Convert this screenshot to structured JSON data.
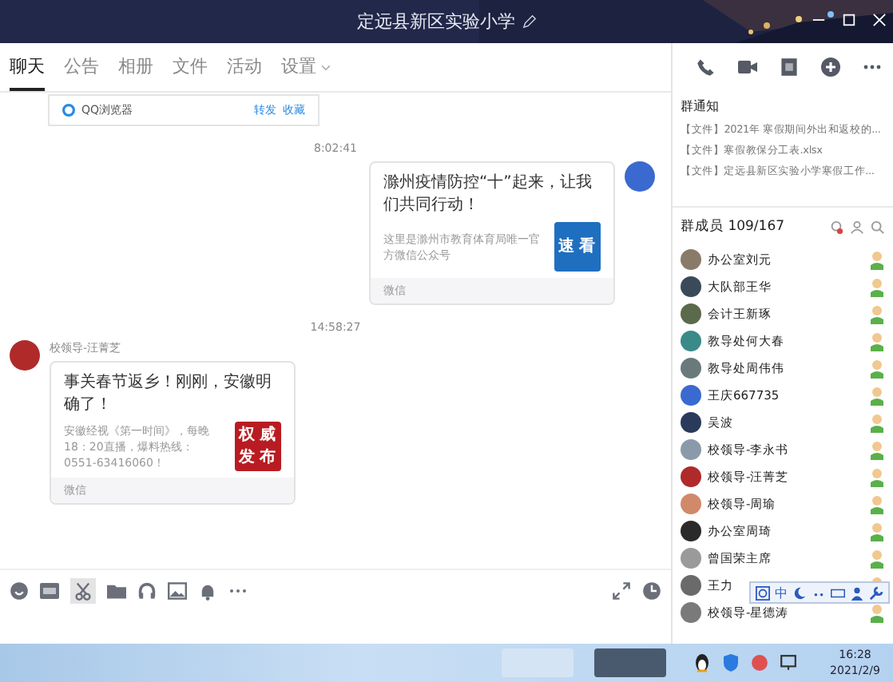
{
  "window": {
    "title": "定远县新区实验小学"
  },
  "tabs": [
    {
      "label": "聊天",
      "selected": true
    },
    {
      "label": "公告",
      "selected": false
    },
    {
      "label": "相册",
      "selected": false
    },
    {
      "label": "文件",
      "selected": false
    },
    {
      "label": "活动",
      "selected": false
    },
    {
      "label": "设置",
      "selected": false
    }
  ],
  "browser_bar": {
    "label": "QQ浏览器",
    "actions": [
      "转发",
      "收藏"
    ]
  },
  "messages": [
    {
      "kind": "time",
      "text": "8:02:41"
    },
    {
      "kind": "sent",
      "title": "滁州疫情防控“十”起来，让我们共同行动！",
      "desc": "这里是滁州市教育体育局唯一官方微信公众号",
      "thumb": "速看",
      "source": "微信"
    },
    {
      "kind": "time",
      "text": "14:58:27"
    },
    {
      "kind": "received",
      "sender": "校领导-汪菁芝",
      "title": "事关春节返乡！刚刚，安徽明确了！",
      "desc": "安徽经视《第一时间》，每晚18：20直播，爆料热线：0551-63416060！",
      "thumb": "权威发布",
      "source": "微信"
    }
  ],
  "notice": {
    "title": "群通知",
    "items": [
      "【文件】2021年 寒假期间外出和返校的...",
      "【文件】寒假教保分工表.xlsx",
      "【文件】定远县新区实验小学寒假工作..."
    ]
  },
  "members": {
    "title": "群成员 109/167",
    "items": [
      {
        "name": "办公室刘元",
        "color": "#8a7a6a"
      },
      {
        "name": "大队部王华",
        "color": "#3a4a5a"
      },
      {
        "name": "会计王新琢",
        "color": "#5a6a4a"
      },
      {
        "name": "教导处何大春",
        "color": "#3a8a8a"
      },
      {
        "name": "教导处周伟伟",
        "color": "#6a7a7a"
      },
      {
        "name": "王庆667735",
        "color": "#3a6ad0"
      },
      {
        "name": "吴波",
        "color": "#2a3a5a"
      },
      {
        "name": "校领导-李永书",
        "color": "#8a9aaa"
      },
      {
        "name": "校领导-汪菁芝",
        "color": "#b02a2a"
      },
      {
        "name": "校领导-周瑜",
        "color": "#d08a6a"
      },
      {
        "name": "办公室周琦",
        "color": "#2a2a2a"
      },
      {
        "name": "曾国荣主席",
        "color": "#9a9a9a"
      },
      {
        "name": "王力",
        "color": "#6a6a6a"
      },
      {
        "name": "校领导-星德涛",
        "color": "#7a7a7a"
      }
    ]
  },
  "ime": {
    "label": "中"
  },
  "clock": {
    "time": "16:28",
    "date": "2021/2/9"
  }
}
